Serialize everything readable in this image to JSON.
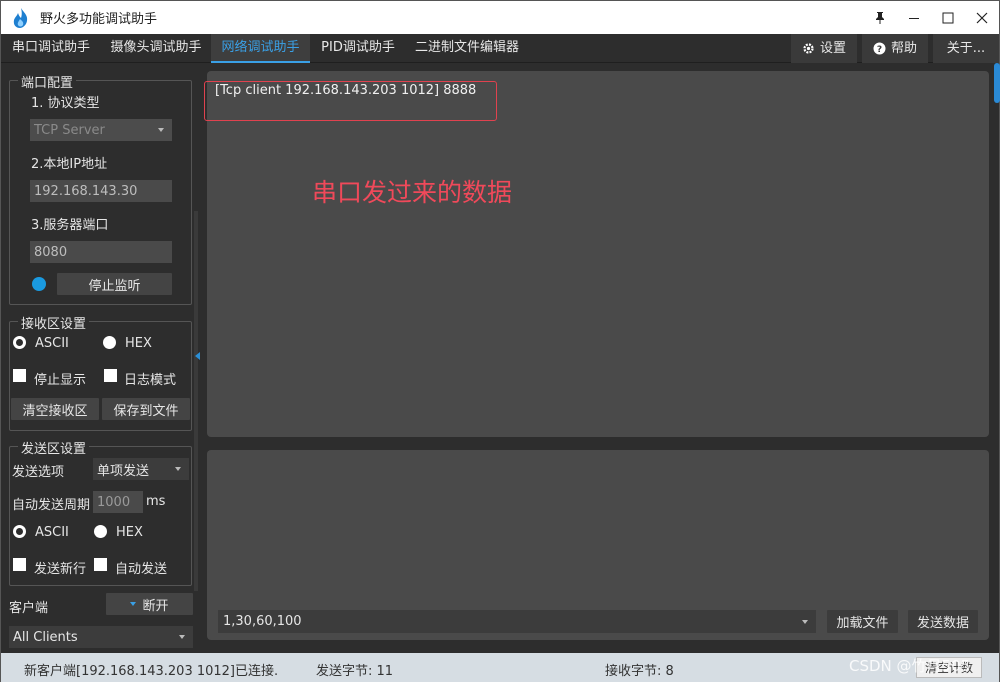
{
  "window": {
    "title": "野火多功能调试助手"
  },
  "tabs": [
    "串口调试助手",
    "摄像头调试助手",
    "网络调试助手",
    "PID调试助手",
    "二进制文件编辑器"
  ],
  "tab_buttons": {
    "settings": "设置",
    "help": "帮助",
    "about": "关于..."
  },
  "port_config": {
    "title": "端口配置",
    "protocol_label": "1. 协议类型",
    "protocol_value": "TCP Server",
    "ip_label": "2.本地IP地址",
    "ip_value": "192.168.143.30",
    "port_label": "3.服务器端口",
    "port_value": "8080",
    "listen_button": "停止监听"
  },
  "receive_settings": {
    "title": "接收区设置",
    "ascii": "ASCII",
    "hex": "HEX",
    "stop_display": "停止显示",
    "log_mode": "日志模式",
    "clear_button": "清空接收区",
    "save_button": "保存到文件"
  },
  "send_settings": {
    "title": "发送区设置",
    "option_label": "发送选项",
    "option_value": "单项发送",
    "period_label": "自动发送周期",
    "period_value": "1000",
    "period_unit": "ms",
    "ascii": "ASCII",
    "hex": "HEX",
    "new_line": "发送新行",
    "auto_send": "自动发送"
  },
  "client": {
    "label": "客户端",
    "disconnect_button": "断开",
    "clients_value": "All Clients"
  },
  "receive_area": {
    "line": "[Tcp client 192.168.143.203 1012] 8888",
    "annotation": "串口发过来的数据"
  },
  "send_area": {
    "input_value": "1,30,60,100",
    "load_file_button": "加载文件",
    "send_button": "发送数据"
  },
  "status": {
    "connection": "新客户端[192.168.143.203 1012]已连接.",
    "sent": "发送字节: 11",
    "received": "接收字节: 8",
    "clear_count": "清空计数",
    "watermark": "CSDN @竹月505"
  },
  "colors": {
    "accent": "#3aa0e6",
    "annotation": "#f0495a",
    "status_bg": "#d6dde3"
  }
}
